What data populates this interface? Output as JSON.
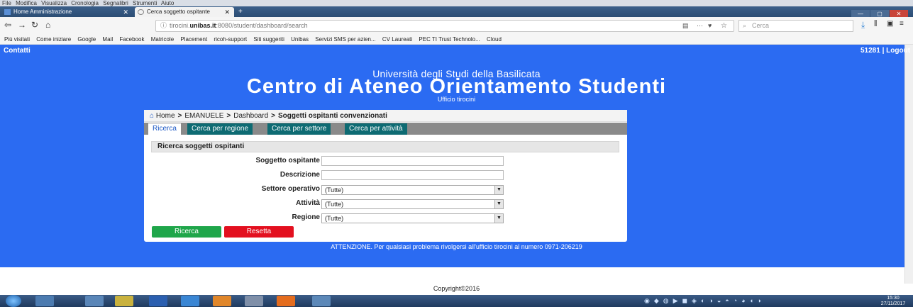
{
  "browser": {
    "menu": [
      "File",
      "Modifica",
      "Visualizza",
      "Cronologia",
      "Segnalibri",
      "Strumenti",
      "Aiuto"
    ],
    "tabs": [
      {
        "label": "Home Amministrazione"
      },
      {
        "label": "Cerca soggetto ospitante"
      }
    ],
    "url_prefix": "tirocini.",
    "url_domain": "unibas.it",
    "url_suffix": ":8080/student/dashboard/search",
    "search_placeholder": "Cerca",
    "bookmarks": [
      "Più visitati",
      "Come iniziare",
      "Google",
      "Mail",
      "Facebook",
      "Matricole",
      "Placement",
      "ricoh-support",
      "Siti suggeriti",
      "Unibas",
      "Servizi SMS per azien...",
      "CV Laureati",
      "PEC TI Trust Technolo...",
      "Cloud"
    ]
  },
  "page": {
    "contacts": "Contatti",
    "user_logout": "51281 | Logout",
    "university": "Università degli Studi della Basilicata",
    "center": "Centro di Ateneo Orientamento Studenti",
    "office": "Ufficio tirocini",
    "breadcrumb": {
      "home": "Home",
      "user": "EMANUELE",
      "dashboard": "Dashboard",
      "current": "Soggetti ospitanti convenzionati"
    },
    "tabs": [
      "Ricerca",
      "Cerca per regione",
      "Cerca per settore",
      "Cerca per attività"
    ],
    "section_title": "Ricerca soggetti ospitanti",
    "form": {
      "soggetto_label": "Soggetto ospitante",
      "descrizione_label": "Descrizione",
      "settore_label": "Settore operativo",
      "settore_value": "(Tutte)",
      "attivita_label": "Attività",
      "attivita_value": "(Tutte)",
      "regione_label": "Regione",
      "regione_value": "(Tutte)"
    },
    "search_button": "Ricerca",
    "reset_button": "Resetta",
    "attention": "ATTENZIONE. Per qualsiasi problema rivolgersi all'ufficio tirocini al numero 0971-206219",
    "copyright": "Copyright©2016"
  },
  "taskbar": {
    "time": "15:30",
    "date": "27/11/2017"
  },
  "colors": {
    "page_bg": "#2b6bf2",
    "tab_bg": "#0e6b73",
    "search_btn": "#1fa64a",
    "reset_btn": "#e3101f"
  }
}
